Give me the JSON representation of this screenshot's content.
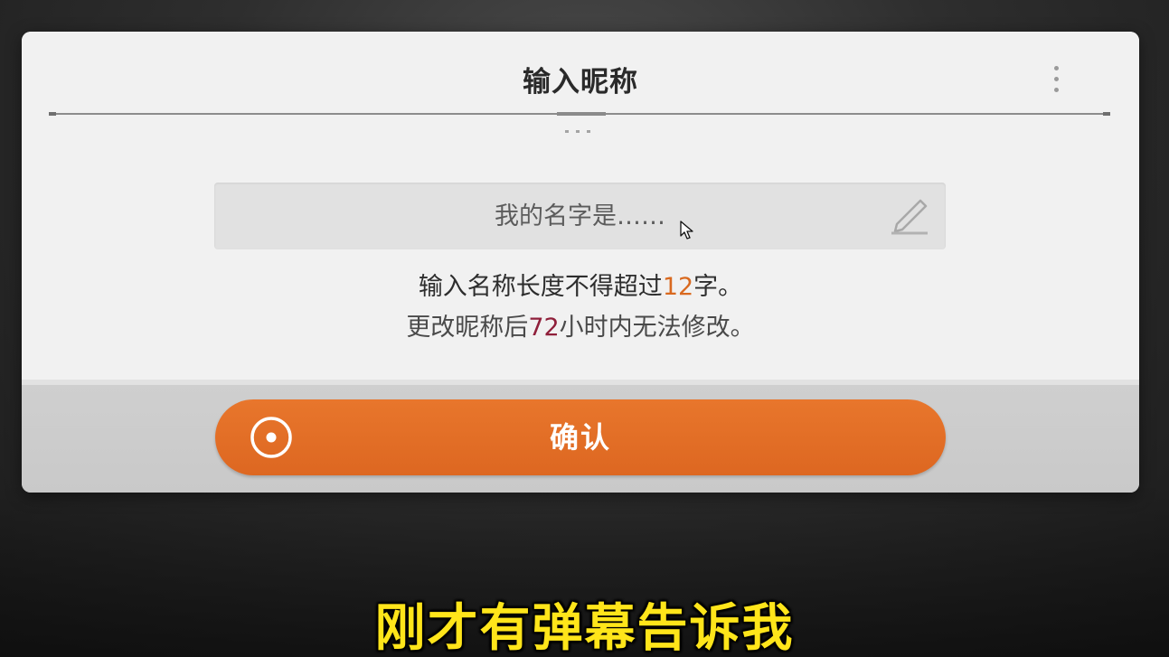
{
  "dialog": {
    "title": "输入昵称",
    "input": {
      "value": "",
      "placeholder": "我的名字是……"
    },
    "hint": {
      "line1_before": "输入名称长度不得超过",
      "line1_number": "12",
      "line1_after": "字。",
      "line2_before": "更改昵称后",
      "line2_number": "72",
      "line2_after": "小时内无法修改。"
    },
    "confirm_label": "确认"
  },
  "subtitle": "刚才有弹幕告诉我",
  "icons": {
    "more": "more-vertical-icon",
    "edit": "pencil-icon",
    "confirm": "radio-circle-icon",
    "cursor": "mouse-cursor-icon"
  },
  "colors": {
    "accent": "#e06b24",
    "limit_number": "#d9691f",
    "hours_number": "#8f1f3a",
    "subtitle": "#ffe51a"
  }
}
